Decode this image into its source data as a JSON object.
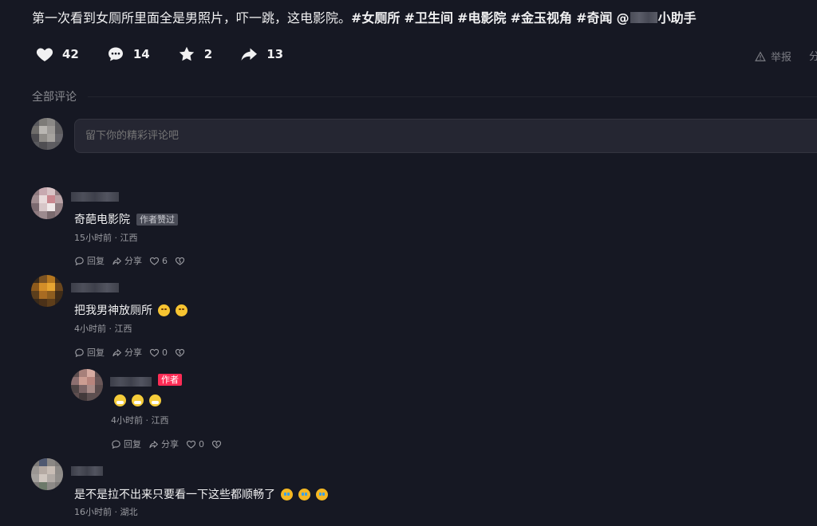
{
  "post": {
    "title_text": "第一次看到女厕所里面全是男照片，吓一跳，这电影院。",
    "tags": [
      "#女厕所",
      "#卫生间",
      "#电影院",
      "#金玉视角",
      "#奇闻"
    ],
    "mention_prefix": "@",
    "mention_suffix": "小助手"
  },
  "actions": {
    "likes": "42",
    "comments": "14",
    "favorites": "2",
    "shares": "13",
    "report_label": "举报",
    "share_label_cut": "分"
  },
  "comments_section": {
    "title": "全部评论",
    "input_placeholder": "留下你的精彩评论吧"
  },
  "comments": [
    {
      "text": "奇葩电影院",
      "badge": "作者赞过",
      "meta": "15小时前 · 江西",
      "reply_label": "回复",
      "share_label": "分享",
      "likes": "6"
    },
    {
      "text": "把我男神放厕所",
      "meta": "4小时前 · 江西",
      "reply_label": "回复",
      "share_label": "分享",
      "likes": "0",
      "emojis": [
        "chick",
        "chick"
      ],
      "reply": {
        "badge": "作者",
        "meta": "4小时前 · 江西",
        "reply_label": "回复",
        "share_label": "分享",
        "likes": "0",
        "emojis": [
          "mask",
          "mask",
          "mask"
        ]
      }
    },
    {
      "text": "是不是拉不出来只要看一下这些都顺畅了",
      "meta": "16小时前 · 湖北",
      "emojis": [
        "cry",
        "cry",
        "cry"
      ]
    }
  ],
  "colors": {
    "background": "#161823",
    "text": "#f1f1f2",
    "muted": "#9a9ba1",
    "author_badge": "#fe2c55"
  }
}
